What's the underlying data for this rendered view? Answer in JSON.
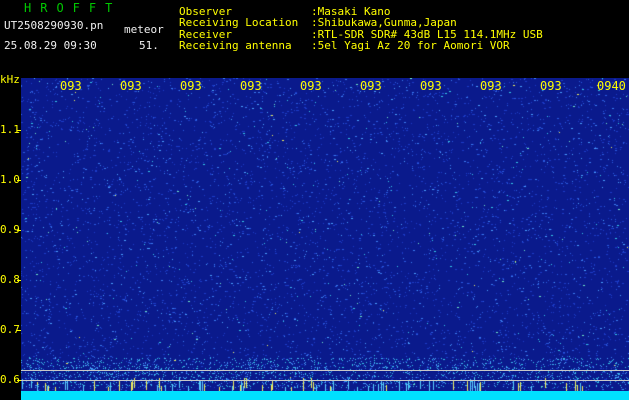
{
  "app": {
    "title": "HROFFT",
    "filename": "UT2508290930.pn",
    "mode": "meteor",
    "datetime": "25.08.29 09:30",
    "count": "51."
  },
  "info": {
    "observer_label": "Observer",
    "observer_value": ":Masaki Kano",
    "location_label": "Receiving Location",
    "location_value": ":Shibukawa,Gunma,Japan",
    "receiver_label": "Receiver",
    "receiver_value": ":RTL-SDR SDR# 43dB L15 114.1MHz USB",
    "antenna_label": "Receiving antenna",
    "antenna_value": ":5el Yagi Az 20 for Aomori VOR"
  },
  "axis": {
    "unit": "kHz",
    "y_ticks": [
      "1.1",
      "1.0",
      "0.9",
      "0.8",
      "0.7",
      "0.6"
    ],
    "x_ticks": [
      "093",
      "093",
      "093",
      "093",
      "093",
      "093",
      "093",
      "093",
      "093",
      "0940"
    ]
  },
  "colors": {
    "background": "#0a1a8c",
    "label": "#ffff00",
    "app_title": "#00c800",
    "baseline": "#00e0ff"
  }
}
